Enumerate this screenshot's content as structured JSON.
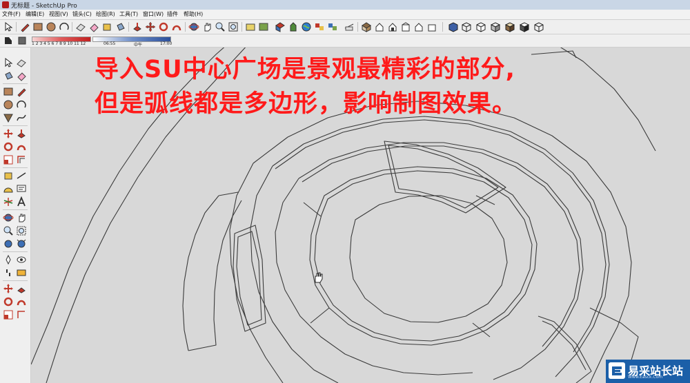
{
  "window": {
    "title": "无标题 - SketchUp Pro"
  },
  "menu": [
    "文件(F)",
    "编辑(E)",
    "视图(V)",
    "镜头(C)",
    "绘图(R)",
    "工具(T)",
    "窗口(W)",
    "插件",
    "帮助(H)"
  ],
  "toolbar": {
    "shadow_months": "1 2 3 4 5 6 7 8 9 10 11 12",
    "shadow_time_start": "06:55",
    "shadow_noon": "中午",
    "shadow_time_end": "17:00"
  },
  "annotation": {
    "line1": "导入SU中心广场是景观最精彩的部分,",
    "line2": "但是弧线都是多边形，影响制图效果。"
  },
  "watermark": {
    "name": "易采站长站",
    "url": "Www.Easck.Com"
  },
  "colors": {
    "annotation": "#ff1a1a",
    "viewport_bg": "#d8d8d8",
    "edges": "#3a3a3a"
  },
  "icons": [
    "select-icon",
    "pencil-icon",
    "rectangle-icon",
    "circle-icon",
    "arc-icon",
    "eraser-icon",
    "paint-bucket-icon",
    "push-pull-icon",
    "move-icon",
    "rotate-icon",
    "offset-icon",
    "orbit-icon",
    "pan-icon",
    "zoom-icon",
    "zoom-extents-icon",
    "components-icon",
    "iso-view-icon",
    "top-view-icon",
    "front-view-icon",
    "xray-icon",
    "wireframe-icon",
    "hidden-line-icon",
    "shaded-icon",
    "textured-icon",
    "monochrome-icon",
    "cursor-hand-icon"
  ]
}
